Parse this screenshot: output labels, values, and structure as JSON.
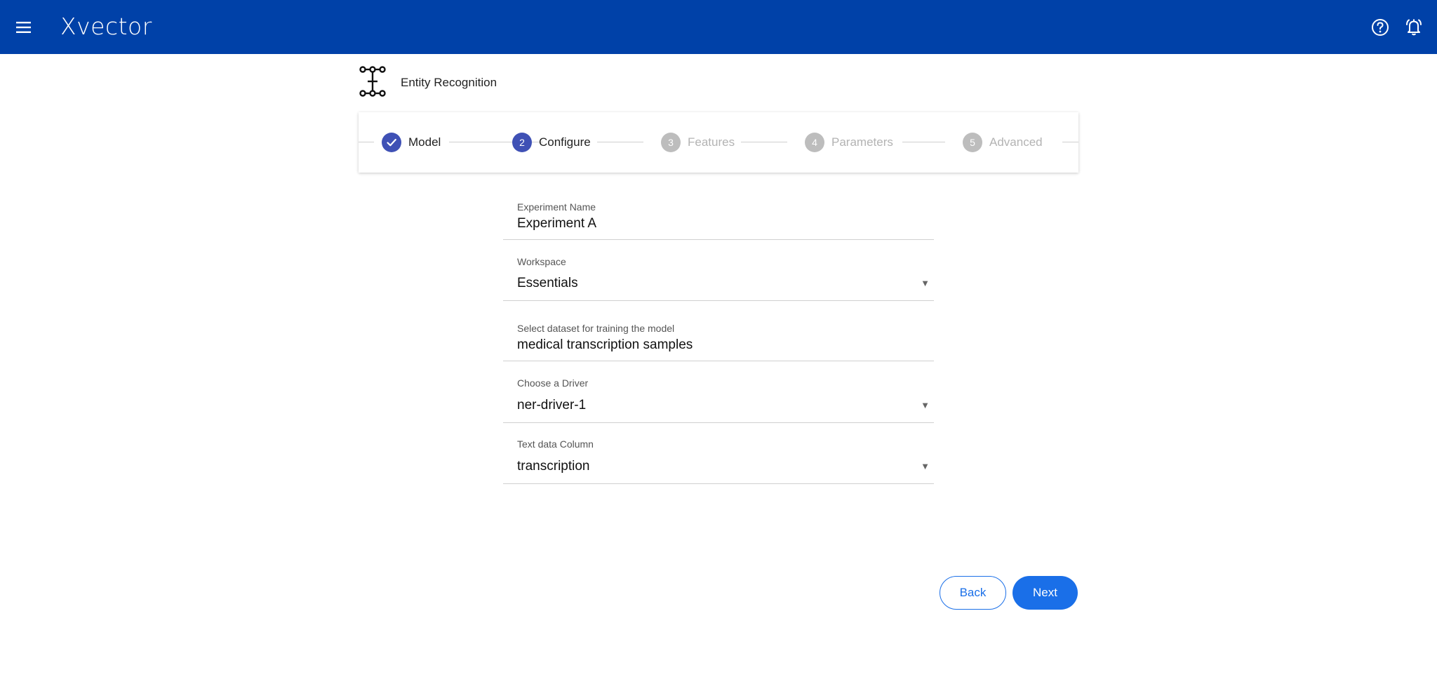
{
  "app": {
    "logo_text": "Xvector",
    "brand_color": "#0041a8",
    "accent_color": "#1a6fe8",
    "step_color": "#3f51b5"
  },
  "header_icons": {
    "menu": "menu-icon",
    "help": "help-icon",
    "notifications": "bell-icon"
  },
  "page": {
    "title": "Entity Recognition",
    "icon": "entity-recognition-icon"
  },
  "stepper": {
    "steps": [
      {
        "number": "1",
        "label": "Model",
        "state": "done"
      },
      {
        "number": "2",
        "label": "Configure",
        "state": "active"
      },
      {
        "number": "3",
        "label": "Features",
        "state": "pending"
      },
      {
        "number": "4",
        "label": "Parameters",
        "state": "pending"
      },
      {
        "number": "5",
        "label": "Advanced",
        "state": "pending"
      }
    ]
  },
  "form": {
    "experiment_name": {
      "label": "Experiment Name",
      "value": "Experiment A"
    },
    "workspace": {
      "label": "Workspace",
      "value": "Essentials"
    },
    "dataset": {
      "label": "Select dataset for training the model",
      "value": "medical transcription samples"
    },
    "driver": {
      "label": "Choose a Driver",
      "value": "ner-driver-1"
    },
    "text_column": {
      "label": "Text data Column",
      "value": "transcription"
    }
  },
  "actions": {
    "back_label": "Back",
    "next_label": "Next"
  }
}
